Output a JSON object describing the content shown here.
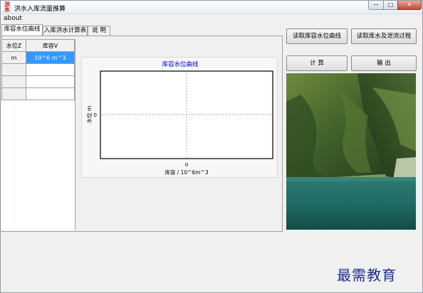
{
  "window": {
    "title": "洪水入库流量推算",
    "icon_text": "洪水",
    "controls": {
      "minimize": "—",
      "maximize": "□",
      "close": "✕"
    }
  },
  "menu": {
    "items": [
      {
        "label": "about"
      }
    ]
  },
  "tabs": [
    {
      "label": "库容水位曲线",
      "active": true
    },
    {
      "label": "入库洪水计算表",
      "active": false
    },
    {
      "label": "说 明",
      "active": false
    }
  ],
  "grid": {
    "columns": [
      "水位Z",
      "库容V"
    ],
    "units": [
      "m",
      "10^6 m^3"
    ],
    "rows": [
      [
        "",
        ""
      ],
      [
        "",
        ""
      ],
      [
        "",
        ""
      ]
    ]
  },
  "chart_data": {
    "type": "line",
    "title": "库容水位曲线",
    "xlabel": "库容 / 10^6m^3",
    "ylabel": "水位 m",
    "x_ticks": [
      "0"
    ],
    "y_ticks": [
      "0"
    ],
    "series": [],
    "xlim": [
      -1,
      1
    ],
    "ylim": [
      -1,
      1
    ],
    "grid": true,
    "title_color": "#0000cc"
  },
  "buttons": {
    "read_level": "读取库容水位曲线",
    "read_flow": "读取库水及泄流过程",
    "calculate": "计 算",
    "output": "输 出"
  },
  "watermark": {
    "text": "最需教育",
    "color": "#1a2f8a"
  }
}
